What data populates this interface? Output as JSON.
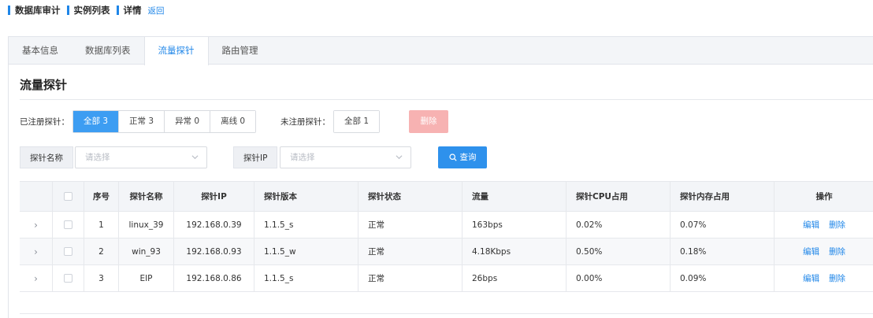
{
  "breadcrumb": {
    "items": [
      "数据库审计",
      "实例列表",
      "详情"
    ],
    "back": "返回"
  },
  "tabs": [
    {
      "label": "基本信息",
      "active": false
    },
    {
      "label": "数据库列表",
      "active": false
    },
    {
      "label": "流量探针",
      "active": true
    },
    {
      "label": "路由管理",
      "active": false
    }
  ],
  "section_title": "流量探针",
  "registered": {
    "label": "已注册探针：",
    "options": [
      "全部 3",
      "正常 3",
      "异常 0",
      "离线 0"
    ],
    "active_index": 0
  },
  "unregistered": {
    "label": "未注册探针：",
    "options": [
      "全部 1"
    ]
  },
  "delete_label": "删除",
  "query": {
    "name_label": "探针名称",
    "name_placeholder": "请选择",
    "ip_label": "探针IP",
    "ip_placeholder": "请选择",
    "button": "查询"
  },
  "table": {
    "headers": [
      "序号",
      "探针名称",
      "探针IP",
      "探针版本",
      "探针状态",
      "流量",
      "探针CPU占用",
      "探针内存占用",
      "操作"
    ],
    "rows": [
      [
        "1",
        "linux_39",
        "192.168.0.39",
        "1.1.5_s",
        "正常",
        "163bps",
        "0.02%",
        "0.07%"
      ],
      [
        "2",
        "win_93",
        "192.168.0.93",
        "1.1.5_w",
        "正常",
        "4.18Kbps",
        "0.50%",
        "0.18%"
      ],
      [
        "3",
        "EIP",
        "192.168.0.86",
        "1.1.5_s",
        "正常",
        "26bps",
        "0.00%",
        "0.09%"
      ]
    ],
    "actions": {
      "edit": "编辑",
      "delete": "删除"
    }
  },
  "colors": {
    "accent": "#1f86e8",
    "active_seg": "#3d9df2",
    "danger_disabled": "#f7b2b2"
  },
  "icons": {
    "expand": "chevron-right-icon",
    "dropdown": "chevron-down-icon",
    "query": "search-icon"
  }
}
